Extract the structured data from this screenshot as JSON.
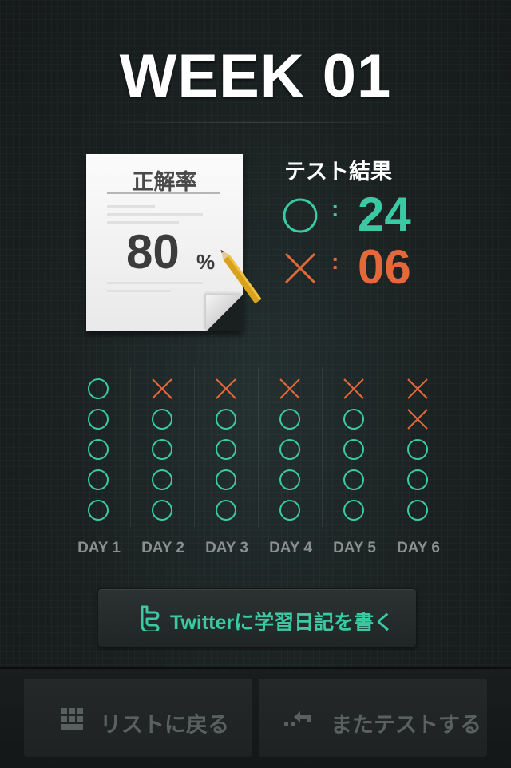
{
  "header": {
    "title": "WEEK 01"
  },
  "score_sheet": {
    "label": "正解率",
    "value": "80",
    "unit": "%"
  },
  "results": {
    "title": "テスト結果",
    "correct": {
      "icon": "circle-icon",
      "colon": ":",
      "count": "24"
    },
    "incorrect": {
      "icon": "cross-icon",
      "colon": ":",
      "count": "06"
    }
  },
  "days": [
    {
      "label": "DAY 1",
      "marks": [
        "circle",
        "circle",
        "circle",
        "circle",
        "circle"
      ]
    },
    {
      "label": "DAY 2",
      "marks": [
        "cross",
        "circle",
        "circle",
        "circle",
        "circle"
      ]
    },
    {
      "label": "DAY 3",
      "marks": [
        "cross",
        "circle",
        "circle",
        "circle",
        "circle"
      ]
    },
    {
      "label": "DAY 4",
      "marks": [
        "cross",
        "circle",
        "circle",
        "circle",
        "circle"
      ]
    },
    {
      "label": "DAY 5",
      "marks": [
        "cross",
        "circle",
        "circle",
        "circle",
        "circle"
      ]
    },
    {
      "label": "DAY 6",
      "marks": [
        "cross",
        "cross",
        "circle",
        "circle",
        "circle"
      ]
    }
  ],
  "twitter_button": {
    "icon": "twitter-icon",
    "label": "Twitterに学習日記を書く"
  },
  "bottom_bar": {
    "list_button": {
      "icon": "grid-icon",
      "label": "リストに戻る"
    },
    "retest_button": {
      "icon": "return-arrow-icon",
      "label": "またテストする"
    }
  },
  "colors": {
    "correct": "#3bc9a3",
    "incorrect": "#e4683a",
    "background": "#1d2121"
  }
}
